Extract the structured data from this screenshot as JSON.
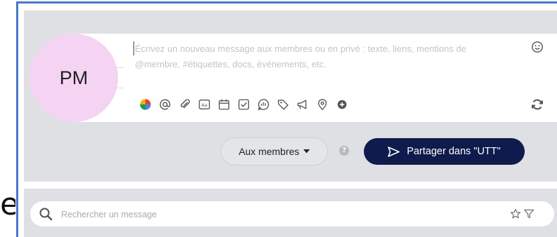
{
  "stray_text": "e",
  "composer": {
    "avatar_initials": "PM",
    "placeholder": "Écrivez un nouveau message aux membres ou en privé : texte, liens, mentions de @membre, #étiquettes, docs, événements, etc.",
    "toolbar_icons": [
      "color-palette-icon",
      "at-mention-icon",
      "paperclip-icon",
      "font-size-icon",
      "calendar-icon",
      "checkbox-icon",
      "poll-icon",
      "tag-icon",
      "megaphone-icon",
      "location-pin-icon",
      "add-circle-icon"
    ],
    "emoji_icon": "smile-icon",
    "refresh_icon": "refresh-icon"
  },
  "actions": {
    "audience_label": "Aux membres",
    "help_label": "?",
    "share_label": "Partager dans \"UTT\""
  },
  "search": {
    "placeholder": "Rechercher un message",
    "value": ""
  },
  "colors": {
    "frame_border": "#4a78c9",
    "panel_bg": "#dfe0e4",
    "avatar_bg": "#f4d3f3",
    "share_bg": "#0f1b4c"
  }
}
